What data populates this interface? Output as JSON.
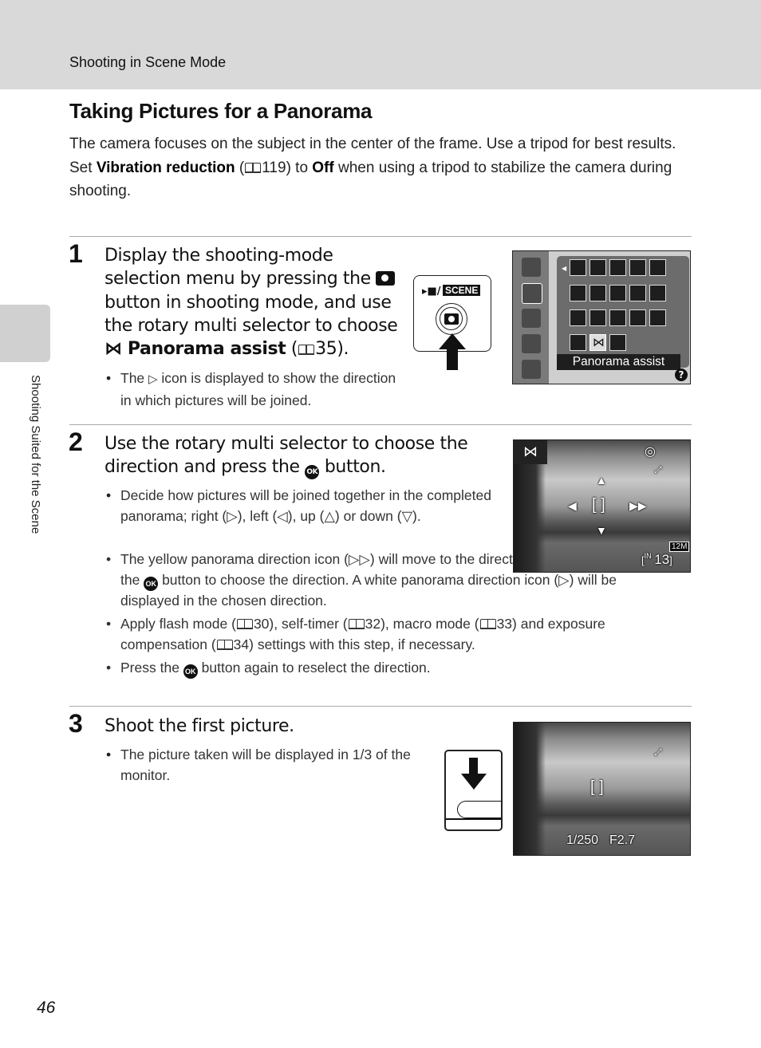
{
  "header": {
    "title": "Shooting in Scene Mode"
  },
  "side_tab": {
    "label": "Shooting Suited for the Scene"
  },
  "page": {
    "title": "Taking Pictures for a Panorama",
    "intro_line1": "The camera focuses on the subject in the center of the frame. Use a tripod for best results.",
    "intro_set": "Set ",
    "intro_vr": "Vibration reduction",
    "intro_vr_ref": "119",
    "intro_to": ") to ",
    "intro_off": "Off",
    "intro_rest": " when using a tripod to stabilize the camera during shooting.",
    "page_number": "46"
  },
  "steps": [
    {
      "number": "1",
      "title_part1": "Display the shooting-mode selection menu by pressing the ",
      "title_part2": " button in shooting mode, and use the rotary multi selector to choose ",
      "title_bold": "Panorama assist",
      "title_ref": "35",
      "bullets": [
        {
          "pre": "The ",
          "post": " icon is displayed to show the direction in which pictures will be joined."
        }
      ],
      "button_figure": {
        "label_mode": "SCENE",
        "icons": [
          "movie-icon",
          "camera-icon",
          "arrow-up-icon"
        ]
      },
      "screen": {
        "selected_item_label": "Panorama assist",
        "help_glyph": "?",
        "left_icons": [
          "camera-mode-icon",
          "scene-mode-icon",
          "smart-portrait-icon",
          "subject-tracking-icon",
          "movie-mode-icon"
        ],
        "grid_rows": [
          [
            "scene-auto-selector",
            "portrait",
            "landscape",
            "sports",
            "night-portrait"
          ],
          [
            "party-indoor",
            "beach",
            "snow",
            "sunset",
            "dusk-dawn"
          ],
          [
            "night-landscape",
            "food",
            "museum",
            "fireworks",
            "copy"
          ],
          [
            "backlighting",
            "panorama-assist",
            "voice-recording"
          ]
        ]
      }
    },
    {
      "number": "2",
      "title_part1": "Use the rotary multi selector to choose the direction and press the ",
      "title_part2": " button.",
      "ok_label": "OK",
      "bullets": [
        {
          "text": "Decide how pictures will be joined together in the completed panorama; right (▷), left (◁), up (△) or down (▽)."
        },
        {
          "text1": "The yellow panorama direction icon (▷▷) will move to the direction pressed and press the ",
          "text2": " button to choose the direction. A white panorama direction icon (▷) will be displayed in the chosen direction."
        },
        {
          "a": "Apply flash mode (",
          "r1": "30",
          "b": "), self-timer (",
          "r2": "32",
          "c": "), macro mode (",
          "r3": "33",
          "d": ") and exposure compensation (",
          "r4": "34",
          "e": ") settings with this step, if necessary."
        },
        {
          "text1": "Press the ",
          "text2": " button again to reselect the direction."
        }
      ],
      "screen": {
        "mode_icon": "panorama-assist-icon",
        "image_size": "12M",
        "memory": "IN",
        "exposures_remaining": "13"
      }
    },
    {
      "number": "3",
      "title": "Shoot the first picture.",
      "bullets": [
        {
          "text": "The picture taken will be displayed in 1/3 of the monitor."
        }
      ],
      "screen": {
        "shutter_speed": "1/250",
        "aperture": "F2.7"
      }
    }
  ]
}
